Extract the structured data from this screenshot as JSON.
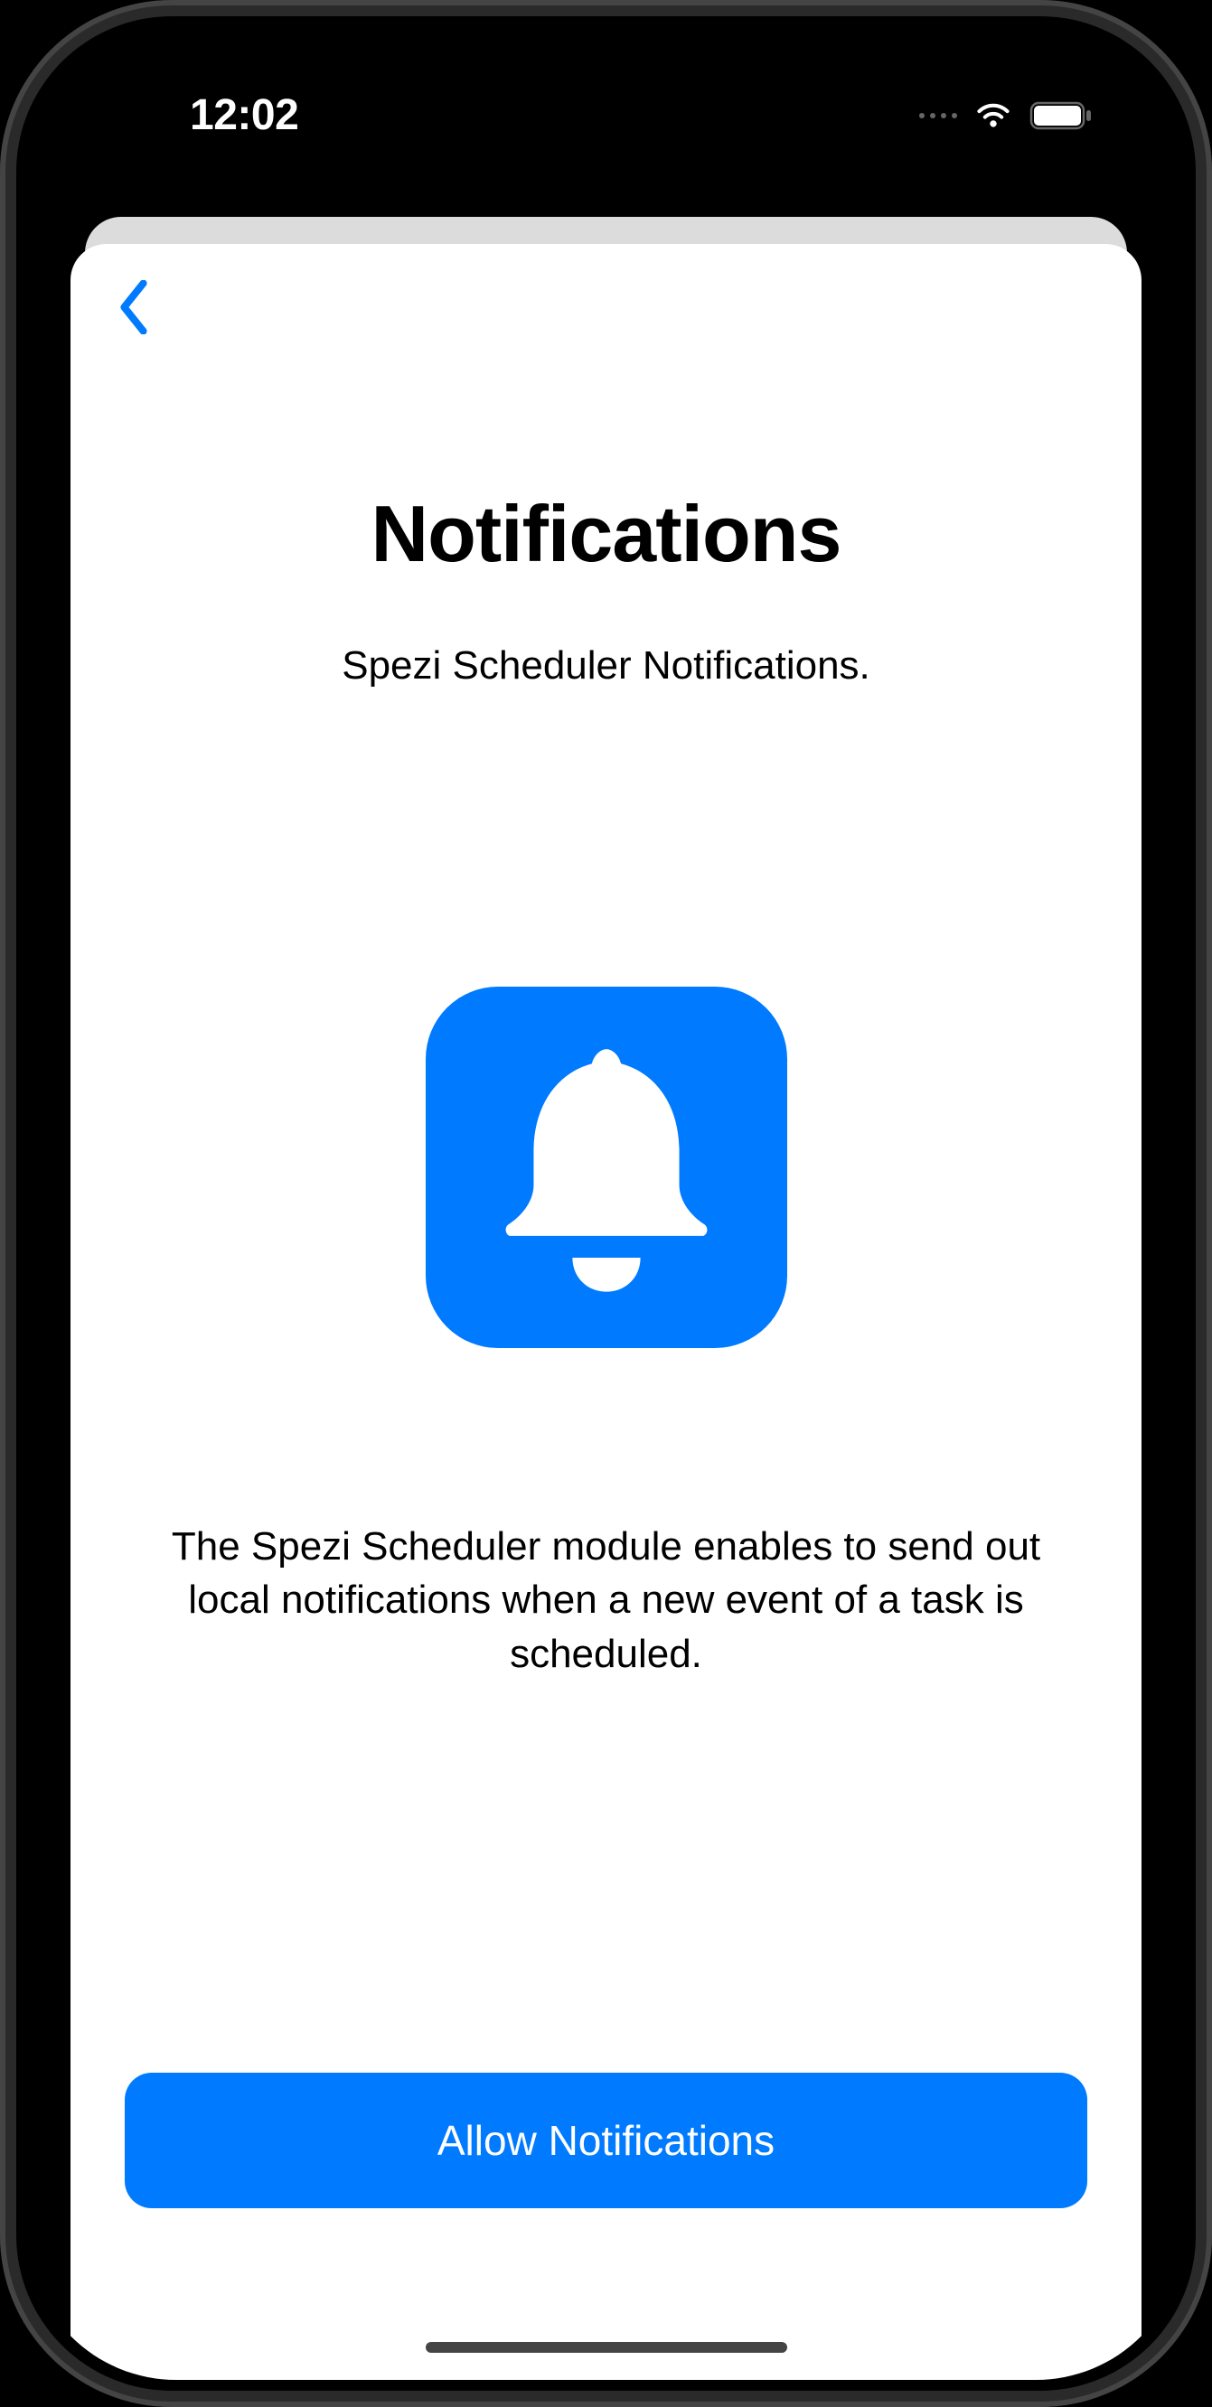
{
  "statusBar": {
    "time": "12:02"
  },
  "navigation": {
    "backLabel": "Back"
  },
  "content": {
    "title": "Notifications",
    "subtitle": "Spezi Scheduler Notifications.",
    "description": "The Spezi Scheduler module enables to send out local notifications when a new event of a task is scheduled."
  },
  "actions": {
    "allowButton": "Allow Notifications"
  },
  "colors": {
    "accent": "#007AFF"
  }
}
